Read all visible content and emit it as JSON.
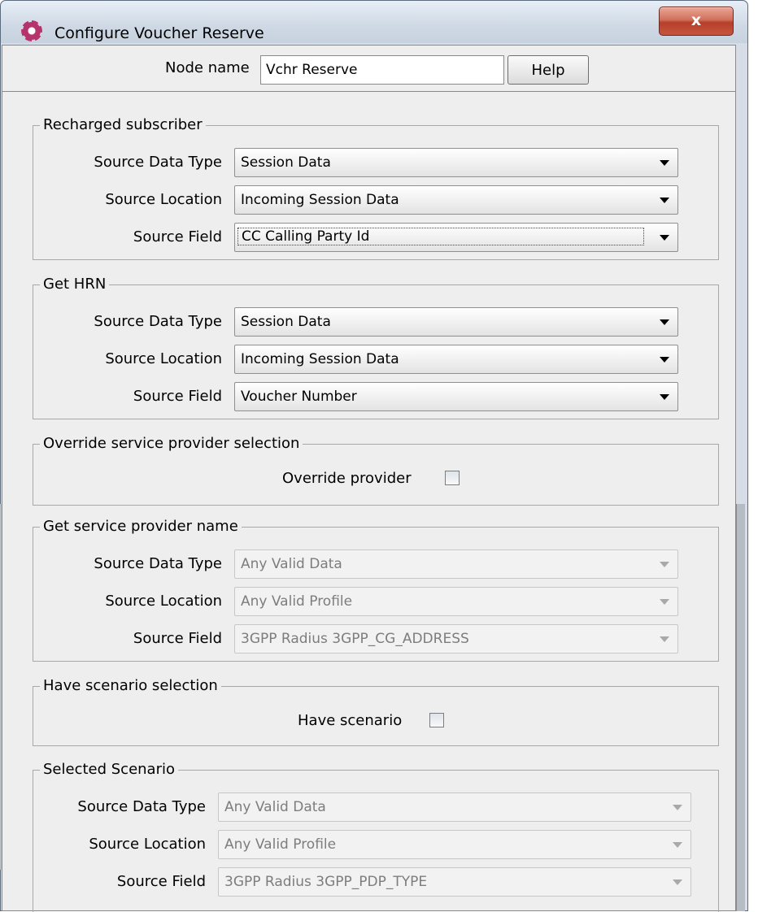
{
  "window": {
    "title": "Configure Voucher Reserve",
    "close_glyph": "x",
    "icon": "app-logo-icon"
  },
  "node": {
    "label": "Node name",
    "value": "Vchr Reserve",
    "help_label": "Help"
  },
  "groups": {
    "recharged": {
      "title": "Recharged subscriber",
      "rows": [
        {
          "label": "Source Data Type",
          "value": "Session Data"
        },
        {
          "label": "Source Location",
          "value": "Incoming Session Data"
        },
        {
          "label": "Source Field",
          "value": "CC Calling Party Id"
        }
      ]
    },
    "hrn": {
      "title": "Get HRN",
      "rows": [
        {
          "label": "Source Data Type",
          "value": "Session Data"
        },
        {
          "label": "Source Location",
          "value": "Incoming Session Data"
        },
        {
          "label": "Source Field",
          "value": "Voucher Number"
        }
      ]
    },
    "override": {
      "title": "Override service provider selection",
      "checkbox_label": "Override provider",
      "checked": false
    },
    "provider": {
      "title": "Get service provider name",
      "rows": [
        {
          "label": "Source Data Type",
          "value": "Any Valid Data"
        },
        {
          "label": "Source Location",
          "value": "Any Valid Profile"
        },
        {
          "label": "Source Field",
          "value": "3GPP Radius 3GPP_CG_ADDRESS"
        }
      ]
    },
    "scenario_sel": {
      "title": "Have scenario selection",
      "checkbox_label": "Have scenario",
      "checked": false
    },
    "scenario": {
      "title": "Selected Scenario",
      "rows": [
        {
          "label": "Source Data Type",
          "value": "Any Valid Data"
        },
        {
          "label": "Source Location",
          "value": "Any Valid Profile"
        },
        {
          "label": "Source Field",
          "value": "3GPP Radius 3GPP_PDP_TYPE"
        }
      ]
    }
  }
}
